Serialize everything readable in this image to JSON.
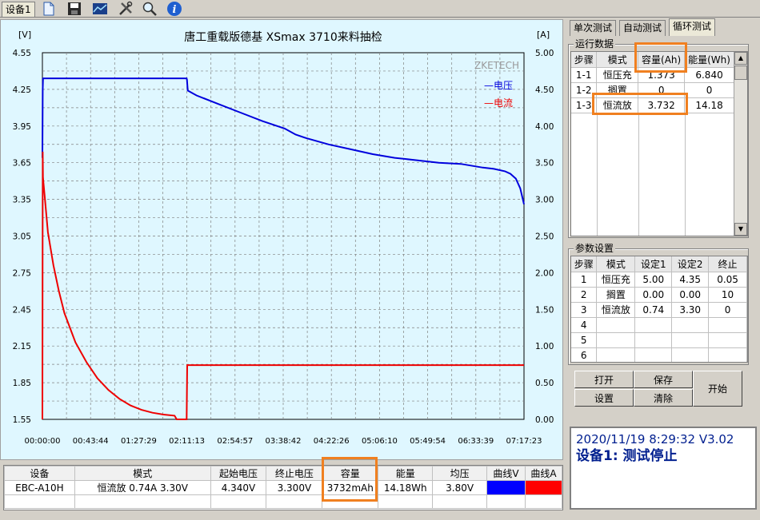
{
  "toolbar": {
    "device_tab": "设备1",
    "buttons": [
      "new-icon",
      "save-icon",
      "chart-icon",
      "tools-icon",
      "search-icon",
      "info-icon"
    ]
  },
  "chart": {
    "title": "唐工重载版德基 XSmax 3710来料抽检",
    "left_unit": "[V]",
    "right_unit": "[A]",
    "watermark": "ZKETECH",
    "legend_voltage": "—电压",
    "legend_current": "—电流",
    "colors": {
      "voltage": "#0000dd",
      "current": "#ee0000",
      "grid": "#808080",
      "bg": "#dff7ff"
    }
  },
  "chart_data": {
    "type": "line",
    "title": "唐工重载版德基 XSmax 3710来料抽检",
    "xlabel": "",
    "ylabel": "[V]",
    "y2label": "[A]",
    "x_ticks": [
      "00:00:00",
      "00:43:44",
      "01:27:29",
      "02:11:13",
      "02:54:57",
      "03:38:42",
      "04:22:26",
      "05:06:10",
      "05:49:54",
      "06:33:39",
      "07:17:23"
    ],
    "y_ticks": [
      "4.55",
      "4.25",
      "3.95",
      "3.65",
      "3.35",
      "3.05",
      "2.75",
      "2.45",
      "2.15",
      "1.85",
      "1.55"
    ],
    "y2_ticks": [
      "5.00",
      "4.50",
      "4.00",
      "3.50",
      "3.00",
      "2.50",
      "2.00",
      "1.50",
      "1.00",
      "0.50",
      "0.00"
    ],
    "ylim": [
      1.55,
      4.55
    ],
    "y2lim": [
      0,
      5
    ],
    "xlim_min": [
      0,
      437.4
    ],
    "grid": true,
    "legend": "top-right",
    "series": [
      {
        "name": "电压",
        "axis": "left",
        "x": [
          0,
          0.3,
          0.6,
          131,
          131.3,
          132,
          140,
          160,
          180,
          200,
          220,
          230,
          240,
          260,
          280,
          300,
          320,
          340,
          360,
          380,
          400,
          410,
          420,
          425,
          430,
          434,
          437.4
        ],
        "y": [
          3.69,
          4.25,
          4.34,
          4.34,
          4.33,
          4.24,
          4.2,
          4.13,
          4.06,
          3.99,
          3.93,
          3.88,
          3.85,
          3.8,
          3.76,
          3.72,
          3.69,
          3.67,
          3.65,
          3.64,
          3.61,
          3.6,
          3.58,
          3.56,
          3.52,
          3.44,
          3.31
        ]
      },
      {
        "name": "电流",
        "axis": "right",
        "x": [
          0,
          0.3,
          0.5,
          2,
          5,
          10,
          15,
          20,
          30,
          40,
          50,
          60,
          70,
          80,
          90,
          100,
          110,
          120,
          122,
          131,
          131.5,
          437.4
        ],
        "y": [
          0,
          3.65,
          3.3,
          3.05,
          2.55,
          2.1,
          1.75,
          1.45,
          1.05,
          0.78,
          0.56,
          0.4,
          0.28,
          0.19,
          0.13,
          0.09,
          0.065,
          0.05,
          0,
          0,
          0.74,
          0.74
        ]
      }
    ]
  },
  "summary": {
    "headers": [
      "设备",
      "模式",
      "起始电压",
      "终止电压",
      "容量",
      "能量",
      "均压",
      "曲线V",
      "曲线A"
    ],
    "row": [
      "EBC-A10H",
      "恒流放 0.74A 3.30V",
      "4.340V",
      "3.300V",
      "3732mAh",
      "14.18Wh",
      "3.80V",
      "",
      ""
    ]
  },
  "right_tabs": [
    "单次测试",
    "自动测试",
    "循环测试"
  ],
  "run_data": {
    "title": "运行数据",
    "headers": [
      "步骤",
      "模式",
      "容量(Ah)",
      "能量(Wh)"
    ],
    "rows": [
      [
        "1-1",
        "恒压充",
        "1.373",
        "6.840"
      ],
      [
        "1-2",
        "搁置",
        "0",
        "0"
      ],
      [
        "1-3",
        "恒流放",
        "3.732",
        "14.18"
      ]
    ]
  },
  "params": {
    "title": "参数设置",
    "headers": [
      "步骤",
      "模式",
      "设定1",
      "设定2",
      "终止"
    ],
    "rows": [
      [
        "1",
        "恒压充",
        "5.00",
        "4.35",
        "0.05"
      ],
      [
        "2",
        "搁置",
        "0.00",
        "0.00",
        "10"
      ],
      [
        "3",
        "恒流放",
        "0.74",
        "3.30",
        "0"
      ],
      [
        "4",
        "",
        "",
        "",
        ""
      ],
      [
        "5",
        "",
        "",
        "",
        ""
      ],
      [
        "6",
        "",
        "",
        "",
        ""
      ]
    ]
  },
  "buttons": {
    "open": "打开",
    "save": "保存",
    "settings": "设置",
    "clear": "清除",
    "start": "开始"
  },
  "status": {
    "line1": "2020/11/19 8:29:32  V3.02",
    "line2": "设备1: 测试停止"
  }
}
